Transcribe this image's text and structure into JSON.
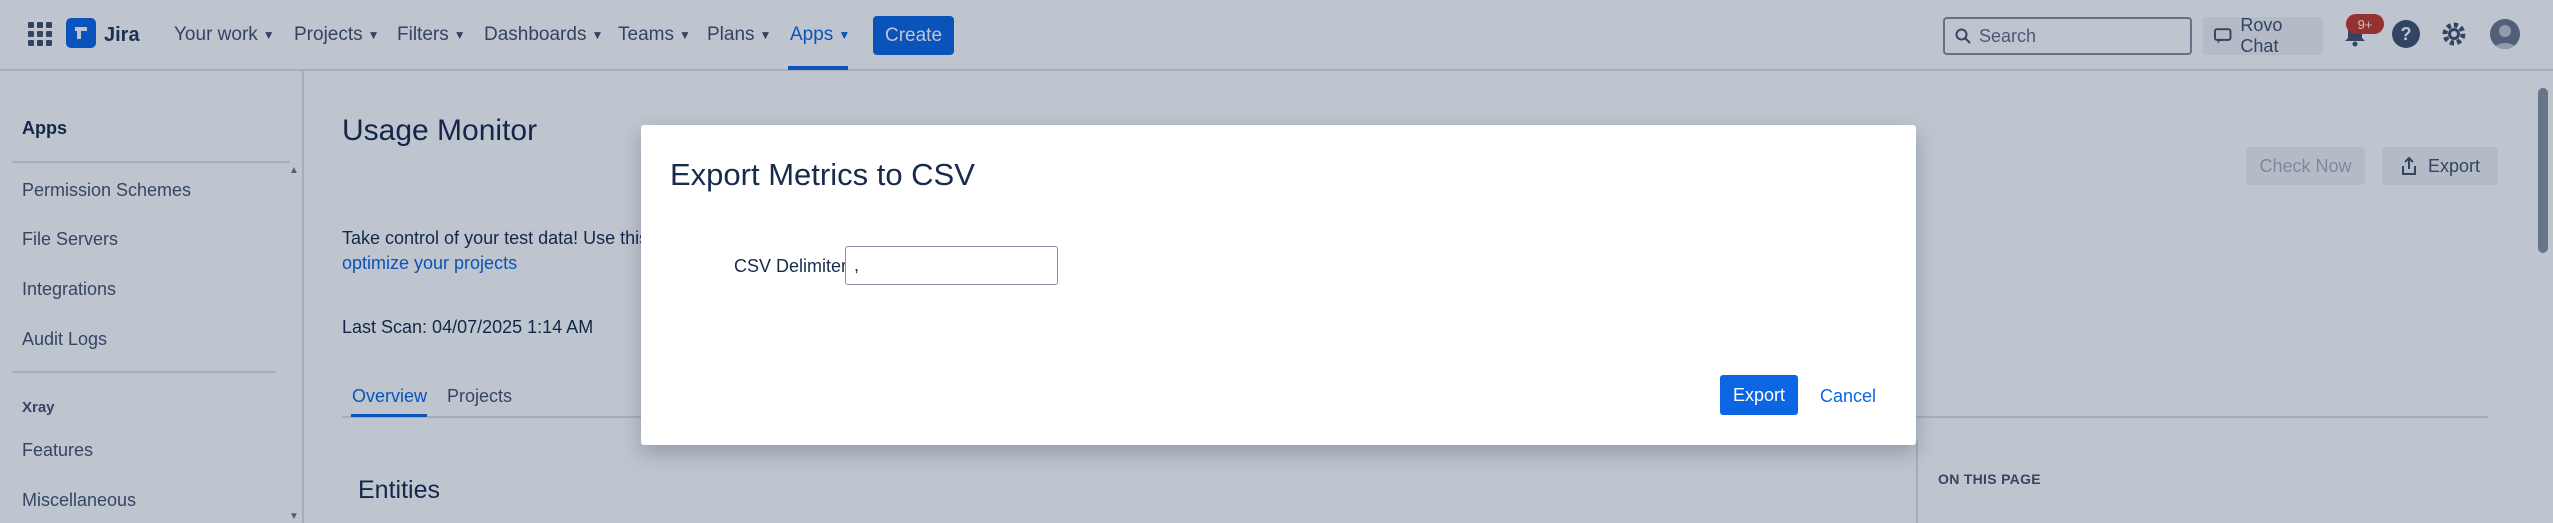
{
  "topnav": {
    "logo": "Jira",
    "items": [
      {
        "label": "Your work"
      },
      {
        "label": "Projects"
      },
      {
        "label": "Filters"
      },
      {
        "label": "Dashboards"
      },
      {
        "label": "Teams"
      },
      {
        "label": "Plans"
      },
      {
        "label": "Apps"
      }
    ],
    "active_item": "Apps",
    "create_label": "Create",
    "search_placeholder": "Search",
    "rovo_label": "Rovo Chat",
    "notifications_badge": "9+",
    "accent_color": "#0c66e4"
  },
  "sidebar": {
    "title": "Apps",
    "items": [
      {
        "label": "Permission Schemes"
      },
      {
        "label": "File Servers"
      },
      {
        "label": "Integrations"
      },
      {
        "label": "Audit Logs"
      }
    ],
    "section": "Xray",
    "section_items": [
      {
        "label": "Features"
      },
      {
        "label": "Miscellaneous"
      }
    ]
  },
  "main": {
    "title": "Usage Monitor",
    "check_now_label": "Check Now",
    "export_label": "Export",
    "intro_text": "Take control of your test data! Use this",
    "intro_link": "optimize your projects",
    "last_scan": "Last Scan: 04/07/2025 1:14 AM",
    "tabs": [
      {
        "label": "Overview"
      },
      {
        "label": "Projects"
      }
    ],
    "active_tab": "Overview",
    "section_title": "Entities",
    "on_this_page": "ON THIS PAGE"
  },
  "modal": {
    "title": "Export Metrics to CSV",
    "delimiter_label": "CSV Delimiter",
    "delimiter_value": ",",
    "export_label": "Export",
    "cancel_label": "Cancel"
  }
}
